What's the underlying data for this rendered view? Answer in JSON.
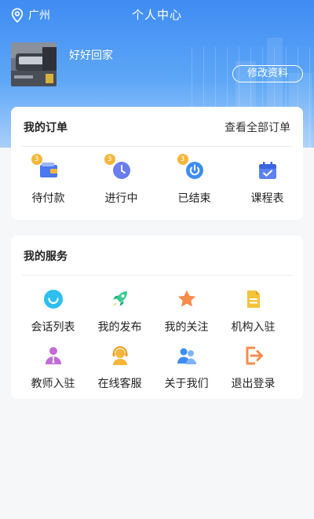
{
  "header": {
    "location": "广州",
    "title": "个人中心"
  },
  "profile": {
    "username": "好好回家",
    "edit_label": "修改资料"
  },
  "orders": {
    "title": "我的订单",
    "view_all": "查看全部订单",
    "items": [
      {
        "label": "待付款",
        "badge": "3",
        "icon": "wallet-icon"
      },
      {
        "label": "进行中",
        "badge": "3",
        "icon": "clock-icon"
      },
      {
        "label": "已结束",
        "badge": "3",
        "icon": "power-icon"
      },
      {
        "label": "课程表",
        "icon": "calendar-icon"
      }
    ]
  },
  "services": {
    "title": "我的服务",
    "items": [
      {
        "label": "会话列表",
        "icon": "chat-icon"
      },
      {
        "label": "我的发布",
        "icon": "rocket-icon"
      },
      {
        "label": "我的关注",
        "icon": "star-icon"
      },
      {
        "label": "机构入驻",
        "icon": "document-icon"
      },
      {
        "label": "教师入驻",
        "icon": "teacher-icon"
      },
      {
        "label": "在线客服",
        "icon": "headset-icon"
      },
      {
        "label": "关于我们",
        "icon": "users-icon"
      },
      {
        "label": "退出登录",
        "icon": "logout-icon"
      }
    ]
  },
  "colors": {
    "header_blue": "#3f8cf3",
    "badge": "#f4b73a",
    "page_bg": "#f6f7f9"
  }
}
